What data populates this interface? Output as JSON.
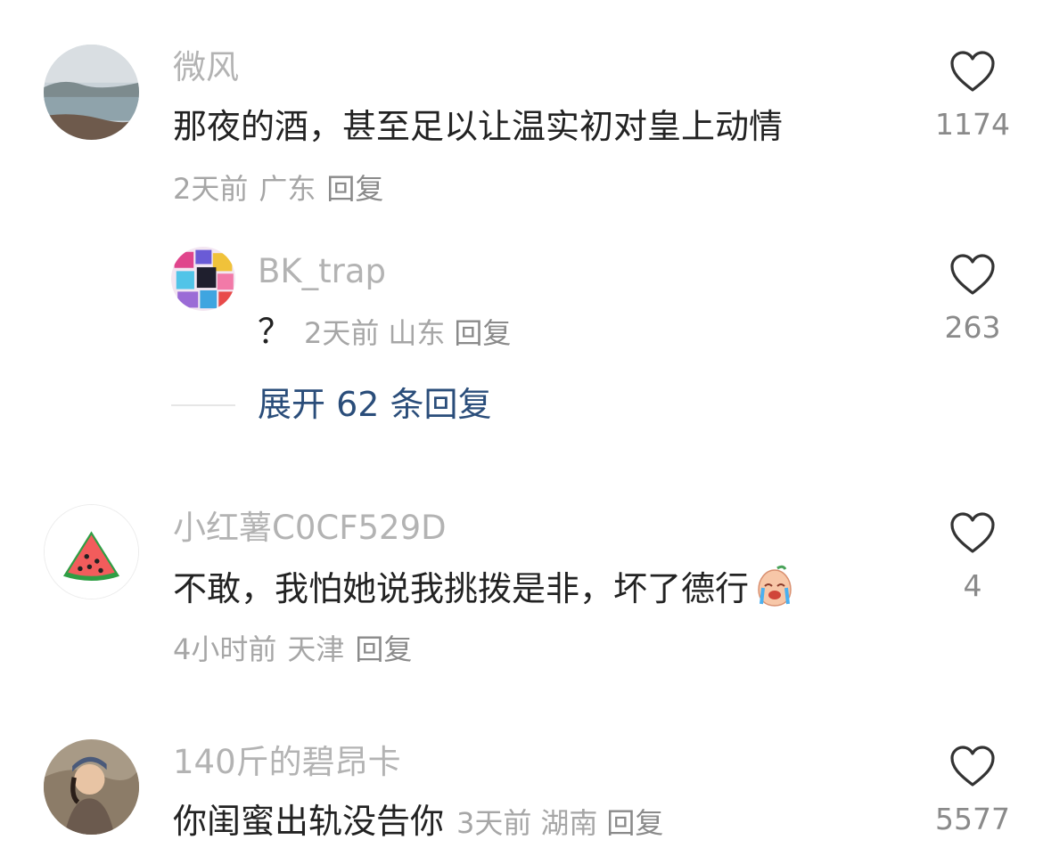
{
  "comments": [
    {
      "username": "微风",
      "text": "那夜的酒，甚至足以让温实初对皇上动情",
      "time": "2天前",
      "location": "广东",
      "reply_label": "回复",
      "likes": "1174",
      "reply": {
        "username": "BK_trap",
        "text": "？",
        "time": "2天前",
        "location": "山东",
        "reply_label": "回复",
        "likes": "263"
      },
      "expand_label": "展开 62 条回复"
    },
    {
      "username": "小红薯C0CF529D",
      "text": "不敢，我怕她说我挑拨是非，坏了德行",
      "emoji": "crying-emoji",
      "time": "4小时前",
      "location": "天津",
      "reply_label": "回复",
      "likes": "4"
    },
    {
      "username": "140斤的碧昂卡",
      "text": "你闺蜜出轨没告你",
      "time": "3天前",
      "location": "湖南",
      "reply_label": "回复",
      "likes": "5577"
    }
  ],
  "colors": {
    "username": "#b3b3b3",
    "text": "#222222",
    "meta": "#a6a6a6",
    "expand": "#2a4d7a"
  }
}
